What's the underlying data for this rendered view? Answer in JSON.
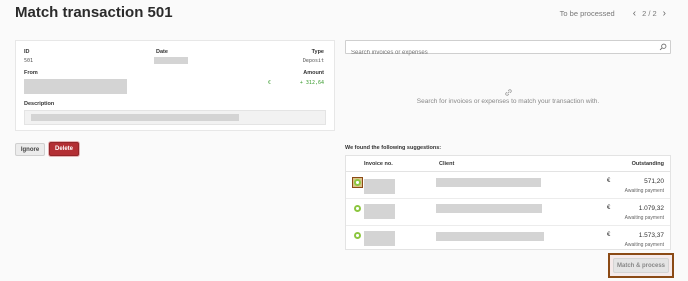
{
  "header": {
    "title": "Match transaction 501",
    "status": "To be processed",
    "pager": "2 / 2",
    "prev_icon": "chevron-left-icon",
    "next_icon": "chevron-right-icon"
  },
  "transaction": {
    "id_label": "ID",
    "id_value": "501",
    "date_label": "Date",
    "type_label": "Type",
    "type_value": "Deposit",
    "from_label": "From",
    "amount_label": "Amount",
    "currency": "€",
    "amount_value": "+ 312,64",
    "description_label": "Description"
  },
  "actions": {
    "ignore": "Ignore",
    "delete": "Delete"
  },
  "search": {
    "placeholder": "Search invoices or expenses",
    "icon": "search-icon",
    "empty_icon": "link-icon",
    "empty_text": "Search for invoices or expenses to match your transaction with."
  },
  "suggestions": {
    "title": "We found the following suggestions:",
    "columns": {
      "invoice": "Invoice no.",
      "client": "Client",
      "outstanding": "Outstanding"
    },
    "rows": [
      {
        "currency": "€",
        "amount": "571,20",
        "status": "Awaiting payment",
        "selected": true
      },
      {
        "currency": "€",
        "amount": "1.079,32",
        "status": "Awaiting payment",
        "selected": false
      },
      {
        "currency": "€",
        "amount": "1.573,37",
        "status": "Awaiting payment",
        "selected": false
      }
    ],
    "match_button": "Match & process"
  },
  "colors": {
    "accent_red": "#b32f34",
    "radio_green": "#8cc63f",
    "highlight_brown": "#8b4a15"
  }
}
